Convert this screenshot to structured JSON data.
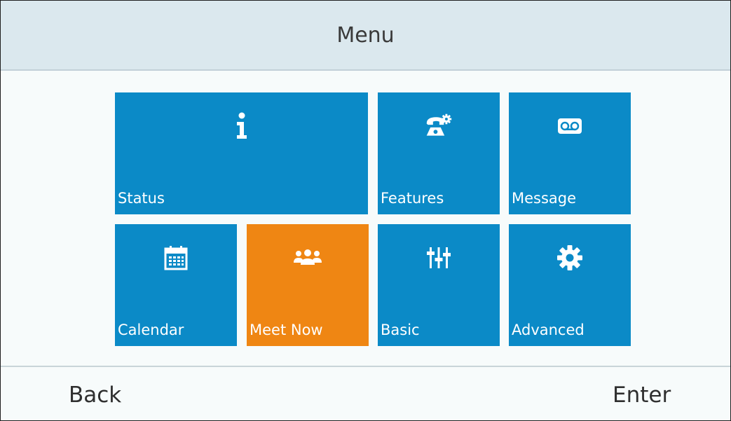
{
  "header": {
    "title": "Menu"
  },
  "menu": {
    "selected": "meet-now",
    "tiles": [
      {
        "id": "status",
        "label": "Status",
        "icon": "info-icon"
      },
      {
        "id": "features",
        "label": "Features",
        "icon": "phone-settings-icon"
      },
      {
        "id": "message",
        "label": "Message",
        "icon": "voicemail-icon"
      },
      {
        "id": "calendar",
        "label": "Calendar",
        "icon": "calendar-icon"
      },
      {
        "id": "meet-now",
        "label": "Meet Now",
        "icon": "people-icon"
      },
      {
        "id": "basic",
        "label": "Basic",
        "icon": "sliders-icon"
      },
      {
        "id": "advanced",
        "label": "Advanced",
        "icon": "gear-icon"
      }
    ]
  },
  "softkeys": {
    "left": "Back",
    "right": "Enter"
  },
  "colors": {
    "tile": "#0b8ac7",
    "tile_selected": "#ef8613",
    "title_bar": "#dbe8ee",
    "background": "#f7fbfb"
  }
}
